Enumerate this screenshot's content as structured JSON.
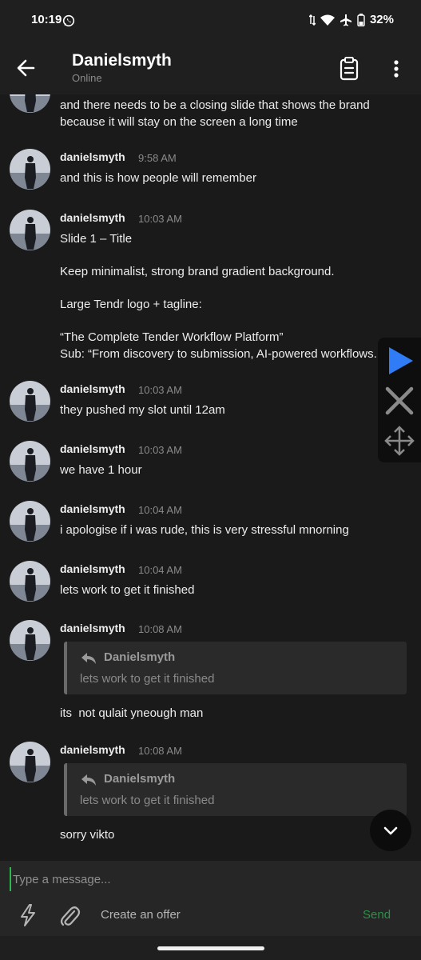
{
  "status_bar": {
    "time": "10:19",
    "battery": "32%",
    "icons": [
      "whatsapp-icon",
      "data-arrows-icon",
      "wifi-icon",
      "airplane-icon",
      "battery-icon"
    ]
  },
  "header": {
    "title": "Danielsmyth",
    "subtitle": "Online",
    "icons": [
      "back-arrow-icon",
      "clipboard-icon",
      "more-vertical-icon"
    ]
  },
  "messages": [
    {
      "author": "",
      "time": "",
      "lines": [
        "and there needs to be a closing slide that shows the brand",
        "because it will stay on the screen a long time"
      ]
    },
    {
      "author": "danielsmyth",
      "time": "9:58 AM",
      "lines": [
        "and this is how people will remember"
      ]
    },
    {
      "author": "danielsmyth",
      "time": "10:03 AM",
      "lines": [
        "Slide 1 – Title",
        "",
        "Keep minimalist, strong brand gradient background.",
        "",
        "Large Tendr logo + tagline:",
        "",
        "“The Complete Tender Workflow Platform”",
        "Sub: “From discovery to submission, AI-powered workflows."
      ]
    },
    {
      "author": "danielsmyth",
      "time": "10:03 AM",
      "lines": [
        "they pushed my slot until 12am"
      ]
    },
    {
      "author": "danielsmyth",
      "time": "10:03 AM",
      "lines": [
        "we have 1 hour"
      ]
    },
    {
      "author": "danielsmyth",
      "time": "10:04 AM",
      "lines": [
        "i apologise if i was rude, this is very stressful mnorning"
      ]
    },
    {
      "author": "danielsmyth",
      "time": "10:04 AM",
      "lines": [
        "lets work to get it finished"
      ]
    },
    {
      "author": "danielsmyth",
      "time": "10:08 AM",
      "quote": {
        "author": "Danielsmyth",
        "text": "lets work to get it finished"
      },
      "lines": [
        "its  not qulait yneough man"
      ]
    },
    {
      "author": "danielsmyth",
      "time": "10:08 AM",
      "quote": {
        "author": "Danielsmyth",
        "text": "lets work to get it finished"
      },
      "lines": [
        "sorry vikto"
      ]
    }
  ],
  "overlay": {
    "icons": [
      "play-icon",
      "close-icon",
      "move-icon"
    ],
    "accent": "#2f7cf6"
  },
  "composer": {
    "placeholder": "Type a message...",
    "offer_label": "Create an offer",
    "send_label": "Send",
    "icons": [
      "flash-icon",
      "paperclip-icon"
    ],
    "send_color": "#2f8f49"
  },
  "colors": {
    "background": "#1a1a1a",
    "bar": "#1f1f1f",
    "quote_bg": "#2a2a2a",
    "caret": "#2db84d"
  }
}
